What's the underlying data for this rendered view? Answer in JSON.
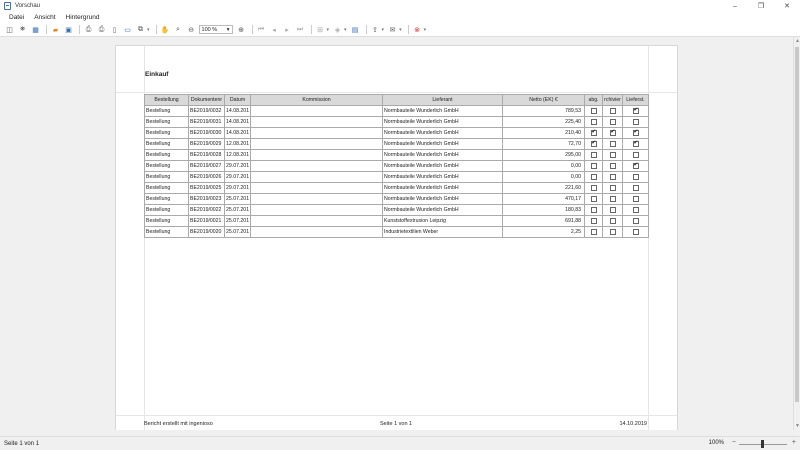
{
  "window": {
    "title": "Vorschau"
  },
  "menu": [
    "Datei",
    "Ansicht",
    "Hintergrund"
  ],
  "toolbar": {
    "zoom_value": "100 %"
  },
  "report": {
    "title": "Einkauf",
    "columns": [
      "Bestellung",
      "Dokumentennr.",
      "Datum",
      "Kommission",
      "Lieferant",
      "Netto (EK) €",
      "abg.",
      "archiviert",
      "Lieferst."
    ],
    "column_headers_visible": [
      "Bestellung",
      "Dokumentenr",
      "Datum",
      "Kommission",
      "Lieferant",
      "Netto (EK) €",
      "abg.",
      "rchivier",
      "Lieferst."
    ],
    "rows": [
      {
        "type": "Bestellung",
        "doc": "BE2019/0032",
        "date": "14.08.201",
        "kommission": "",
        "supplier": "Normbauteile Wunderlich GmbH",
        "netto": "789,53",
        "abg": false,
        "arch": false,
        "lief": true
      },
      {
        "type": "Bestellung",
        "doc": "BE2019/0031",
        "date": "14.08.201",
        "kommission": "",
        "supplier": "Normbauteile Wunderlich GmbH",
        "netto": "225,40",
        "abg": false,
        "arch": false,
        "lief": false
      },
      {
        "type": "Bestellung",
        "doc": "BE2019/0030",
        "date": "14.08.201",
        "kommission": "",
        "supplier": "Normbauteile Wunderlich GmbH",
        "netto": "210,40",
        "abg": true,
        "arch": true,
        "lief": true
      },
      {
        "type": "Bestellung",
        "doc": "BE2019/0029",
        "date": "12.08.201",
        "kommission": "",
        "supplier": "Normbauteile Wunderlich GmbH",
        "netto": "72,70",
        "abg": true,
        "arch": false,
        "lief": true
      },
      {
        "type": "Bestellung",
        "doc": "BE2019/0028",
        "date": "12.08.201",
        "kommission": "",
        "supplier": "Normbauteile Wunderlich GmbH",
        "netto": "295,00",
        "abg": false,
        "arch": false,
        "lief": false
      },
      {
        "type": "Bestellung",
        "doc": "BE2019/0027",
        "date": "29.07.201",
        "kommission": "",
        "supplier": "Normbauteile Wunderlich GmbH",
        "netto": "0,00",
        "abg": false,
        "arch": false,
        "lief": true
      },
      {
        "type": "Bestellung",
        "doc": "BE2019/0026",
        "date": "29.07.201",
        "kommission": "",
        "supplier": "Normbauteile Wunderlich GmbH",
        "netto": "0,00",
        "abg": false,
        "arch": false,
        "lief": false
      },
      {
        "type": "Bestellung",
        "doc": "BE2019/0025",
        "date": "29.07.201",
        "kommission": "",
        "supplier": "Normbauteile Wunderlich GmbH",
        "netto": "221,60",
        "abg": false,
        "arch": false,
        "lief": false
      },
      {
        "type": "Bestellung",
        "doc": "BE2019/0023",
        "date": "25.07.201",
        "kommission": "",
        "supplier": "Normbauteile Wunderlich GmbH",
        "netto": "470,17",
        "abg": false,
        "arch": false,
        "lief": false
      },
      {
        "type": "Bestellung",
        "doc": "BE2019/0022",
        "date": "25.07.201",
        "kommission": "",
        "supplier": "Normbauteile Wunderlich GmbH",
        "netto": "180,83",
        "abg": false,
        "arch": false,
        "lief": false
      },
      {
        "type": "Bestellung",
        "doc": "BE2019/0021",
        "date": "25.07.201",
        "kommission": "",
        "supplier": "Kunststoffextrusion Leipzig",
        "netto": "691,88",
        "abg": false,
        "arch": false,
        "lief": false
      },
      {
        "type": "Bestellung",
        "doc": "BE2019/0020",
        "date": "25.07.201",
        "kommission": "",
        "supplier": "Industrietextilien Weber",
        "netto": "2,25",
        "abg": false,
        "arch": false,
        "lief": false
      }
    ],
    "footer": {
      "left": "Bericht erstellt mit ingenioso",
      "center": "Seite 1 von 1",
      "right": "14.10.2019"
    }
  },
  "status": {
    "text": "Seite 1 von 1",
    "zoom": "100%"
  }
}
